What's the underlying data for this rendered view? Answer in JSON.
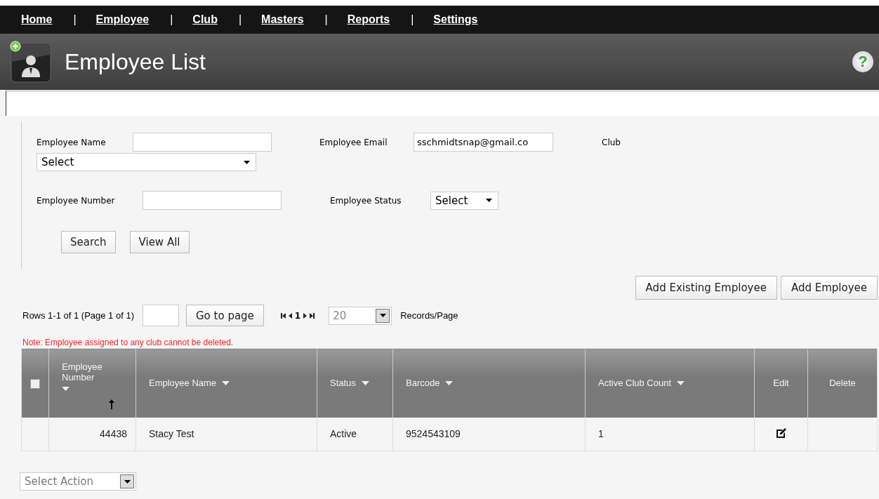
{
  "nav": [
    {
      "kind": "link",
      "label": "Home"
    },
    {
      "kind": "separator",
      "label": "|"
    },
    {
      "kind": "link",
      "label": "Employee"
    },
    {
      "kind": "separator",
      "label": "|"
    },
    {
      "kind": "link",
      "label": "Club"
    },
    {
      "kind": "separator",
      "label": "|"
    },
    {
      "kind": "link",
      "label": "Masters"
    },
    {
      "kind": "separator",
      "label": "|"
    },
    {
      "kind": "link",
      "label": "Reports"
    },
    {
      "kind": "separator",
      "label": "|"
    },
    {
      "kind": "link",
      "label": "Settings"
    }
  ],
  "header": {
    "title": "Employee List",
    "help": "?"
  },
  "filters": {
    "employee_name": {
      "label": "Employee Name"
    },
    "employee_email": {
      "label": "Employee Email",
      "value": "sschmidtsnap@gmail.co"
    },
    "club": {
      "label": "Club",
      "value": "Select"
    },
    "employee_number": {
      "label": "Employee Number"
    },
    "employee_status": {
      "label": "Employee Status",
      "value": "Select"
    },
    "buttons": [
      "Search",
      "View All"
    ]
  },
  "actions": [
    "Add Existing Employee",
    "Add Employee"
  ],
  "pager": {
    "summary": "Rows 1-1 of 1 (Page 1 of 1)",
    "go_button": "Go to page",
    "current_page": "1",
    "records_per_page": "20",
    "records_label": "Records/Page"
  },
  "note": "Note: Employee assigned to any club cannot be deleted.",
  "table": {
    "select_all": {
      "checked": false
    },
    "columns": [
      {
        "label": "Employee Number",
        "sortable": true,
        "sorted": true
      },
      {
        "label": "Employee Name",
        "sortable": true,
        "sorted": false
      },
      {
        "label": "Status",
        "sortable": true,
        "sorted": false
      },
      {
        "label": "Barcode",
        "sortable": true,
        "sorted": false
      },
      {
        "label": "Active Club Count",
        "sortable": true,
        "sorted": false
      },
      {
        "label": "Edit",
        "sortable": false,
        "sorted": false
      },
      {
        "label": "Delete",
        "sortable": false,
        "sorted": false
      }
    ],
    "rows": [
      {
        "cells": [
          "44438",
          "Stacy Test",
          "Active",
          "9524543109",
          "1"
        ],
        "editable": true,
        "deletable": false
      }
    ]
  },
  "bulk_action": {
    "value": "Select Action"
  }
}
